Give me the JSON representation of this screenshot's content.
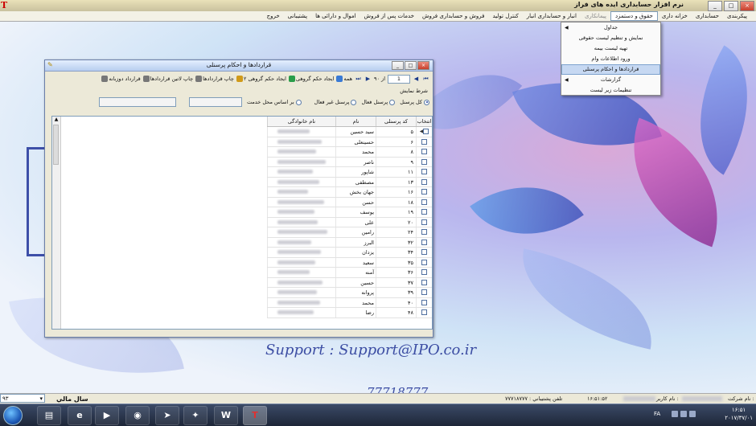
{
  "titlebar": {
    "title": "نرم افزار حسابداری ایده های فراز",
    "buttons": {
      "minimize": "_",
      "maximize": "□",
      "close": "×"
    }
  },
  "menubar": {
    "items": [
      {
        "label": "پیکربندی",
        "state": "normal"
      },
      {
        "label": "حسابداری",
        "state": "normal"
      },
      {
        "label": "خزانه داری",
        "state": "normal"
      },
      {
        "label": "حقوق و دستمزد",
        "state": "active"
      },
      {
        "label": "پیمانکاری",
        "state": "disabled"
      },
      {
        "label": "انبار و حسابداری انبار",
        "state": "normal"
      },
      {
        "label": "کنترل تولید",
        "state": "normal"
      },
      {
        "label": "فروش و حسابداری فروش",
        "state": "normal"
      },
      {
        "label": "خدمات پس از فروش",
        "state": "normal"
      },
      {
        "label": "اموال و دارائی ها",
        "state": "normal"
      },
      {
        "label": "پشتیبانی",
        "state": "normal"
      },
      {
        "label": "خروج",
        "state": "normal"
      }
    ]
  },
  "dropdown": {
    "items": [
      {
        "label": "جداول",
        "submenu": true,
        "highlight": false
      },
      {
        "label": "نمایش و تنظیم لیست حقوقی",
        "submenu": false,
        "highlight": false
      },
      {
        "label": "تهیه لیست بیمه",
        "submenu": false,
        "highlight": false
      },
      {
        "label": "ورود اطلاعات وام",
        "submenu": false,
        "highlight": false
      },
      {
        "label": "قراردادها و احکام پرسنلی",
        "submenu": false,
        "highlight": true
      },
      {
        "label": "گزارشات",
        "submenu": true,
        "highlight": false
      },
      {
        "label": "تنظیمات زیر لیست",
        "submenu": false,
        "highlight": false
      }
    ]
  },
  "child_window": {
    "title": "قراردادها و احکام پرسنلی",
    "toolbar": {
      "first": "⏮",
      "prev": "◀",
      "record": "1",
      "of": "از ۹۰",
      "next": "▶",
      "last": "⏭",
      "items": [
        {
          "label": "همه",
          "color": "#3a7bd5"
        },
        {
          "label": "ایجاد حکم گروهی",
          "color": "#2a9d4a"
        },
        {
          "label": "ایجاد حکم گروهی ۲",
          "color": "#d09a1a"
        },
        {
          "label": "چاپ قراردادها",
          "color": "#777777"
        },
        {
          "label": "چاپ لاتین قراردادها",
          "color": "#777777"
        },
        {
          "label": "قرارداد دوزبانه",
          "color": "#777777"
        }
      ]
    },
    "filter": {
      "section_label": "شرط نمایش",
      "options": [
        {
          "label": "کل پرسنل",
          "selected": true
        },
        {
          "label": "پرسنل فعال",
          "selected": false
        },
        {
          "label": "پرسنل غیر فعال",
          "selected": false
        },
        {
          "label": "بر اساس محل خدمت",
          "selected": false
        }
      ]
    },
    "grid": {
      "columns": {
        "select": "انتخاب",
        "code": "کد پرسنلی",
        "name": "نام",
        "family": "نام خانوادگی"
      },
      "rows": [
        {
          "code": "۵",
          "name": "سید حسین",
          "current": true
        },
        {
          "code": "۶",
          "name": "حسینعلی"
        },
        {
          "code": "۸",
          "name": "محمد"
        },
        {
          "code": "۹",
          "name": "ناصر"
        },
        {
          "code": "۱۱",
          "name": "شاپور"
        },
        {
          "code": "۱۳",
          "name": "مصطفی"
        },
        {
          "code": "۱۶",
          "name": "جهان بخش"
        },
        {
          "code": "۱۸",
          "name": "حسن"
        },
        {
          "code": "۱۹",
          "name": "یوسف"
        },
        {
          "code": "۲۰",
          "name": "علی"
        },
        {
          "code": "۲۴",
          "name": "رامین"
        },
        {
          "code": "۳۲",
          "name": "البرز"
        },
        {
          "code": "۳۴",
          "name": "یزدان"
        },
        {
          "code": "۳۵",
          "name": "سعید"
        },
        {
          "code": "۳۶",
          "name": "آمنه"
        },
        {
          "code": "۳۷",
          "name": "حسین"
        },
        {
          "code": "۳۹",
          "name": "پروانه"
        },
        {
          "code": "۴۰",
          "name": "محمد"
        },
        {
          "code": "۴۸",
          "name": "رضا"
        }
      ]
    }
  },
  "desktop": {
    "support_line": "Support  : Support@IPO.co.ir",
    "phone_line": "77718777"
  },
  "statusbar": {
    "year_value": "۹۳",
    "year_label": "سال مالي",
    "phone": "تلفن پشتيباني : ۷۷۷۱۸۷۷۷",
    "time": "۱۶:۵۱:۵۲",
    "user_label": "نام کاربر :",
    "company_label": "نام شرکت :",
    "version": "نسخه: ۳.۵",
    "date": "۱۴۰۱/۳۷/۰۱"
  },
  "taskbar": {
    "apps": [
      {
        "name": "file-explorer-icon",
        "glyph": "▤"
      },
      {
        "name": "internet-explorer-icon",
        "glyph": "e"
      },
      {
        "name": "media-player-icon",
        "glyph": "▶"
      },
      {
        "name": "chrome-icon",
        "glyph": "◉"
      },
      {
        "name": "telegram-icon",
        "glyph": "➤"
      },
      {
        "name": "tool-icon",
        "glyph": "✦"
      },
      {
        "name": "word-icon",
        "glyph": "W"
      },
      {
        "name": "ideh-app-icon",
        "glyph": "T"
      }
    ],
    "lang": "FA",
    "clock_time": "۱۶:۵۱",
    "clock_date": "۲۰۱۷/۳۷/۰۱"
  }
}
